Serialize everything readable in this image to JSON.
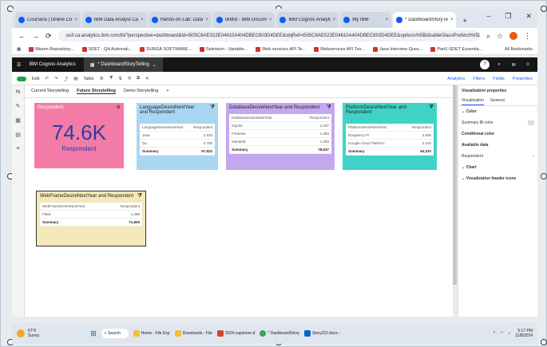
{
  "browser": {
    "tabs": [
      {
        "label": "Coursera | Online Co",
        "active": false
      },
      {
        "label": "IBM Data Analyst Ca",
        "active": false
      },
      {
        "label": "Hands-on Lab: Data",
        "active": false
      },
      {
        "label": "IBMid - IBM Docum",
        "active": false
      },
      {
        "label": "IBM Cognos Analyti",
        "active": false
      },
      {
        "label": "My IBM",
        "active": false
      },
      {
        "label": "* DashboardStoryTe",
        "active": true
      }
    ],
    "new_tab": "+",
    "url": "us3.ca.analytics.ibm.com/bi/?perspective=dashboard&id=i505C8AE022E04610A404DBEC603D4DEE&objRef=i505C8AE022E04610A404DBEC603D4DEE&options%5BdisableGlassPrefetch%5D=true...",
    "bookmarks": [
      "Maven Repository...",
      "SDET - QA Automati...",
      "DURGA SOFTWARE...",
      "Selenium - Variable...",
      "Web services API Te...",
      "Webservices API Tes...",
      "Java Interview Ques...",
      "Part1-SDET Essentia..."
    ],
    "all_bookmarks": "All Bookmarks"
  },
  "cognos": {
    "brand": "IBM Cognos Analytics",
    "doc_tab": "* DashboardStoryTelling",
    "toolbar": {
      "edit": "Edit",
      "table": "Table",
      "analytics": "Analytics",
      "filters": "Filters",
      "fields": "Fields",
      "properties": "Properties"
    },
    "story_tabs": [
      {
        "label": "Current Storytelling",
        "active": false
      },
      {
        "label": "Future Storytelling",
        "active": true
      },
      {
        "label": "Demo Storytelling",
        "active": false
      }
    ],
    "kpi": {
      "title": "Respondent",
      "value": "74.6K",
      "label": "Respondent"
    },
    "widgets": [
      {
        "title": "LanguageDesireNextYear and Respondent",
        "col1": "LanguageDesireNextYear",
        "col2": "Respondent",
        "rows": [
          [
            "Java",
            "2,933"
          ],
          [
            "Go",
            "2,768"
          ]
        ],
        "summary": [
          "Summary",
          "97,922"
        ]
      },
      {
        "title": "DatabaseDesireNextYear and Respondent",
        "col1": "DatabaseDesireNextYear",
        "col2": "Respondent",
        "rows": [
          [
            "SQLite",
            "2,437"
          ],
          [
            "Firebase",
            "1,450"
          ],
          [
            "MariaDB",
            "1,300"
          ]
        ],
        "summary": [
          "Summary",
          "78,637"
        ]
      },
      {
        "title": "PlatformDesireNextYear and Respondent",
        "col1": "PlatformDesireNextYear",
        "col2": "Respondent",
        "rows": [
          [
            "Raspberry Pi",
            "2,605"
          ],
          [
            "Google Cloud Platform",
            "2,410"
          ]
        ],
        "summary": [
          "Summary",
          "64,220"
        ]
      },
      {
        "title": "WebFrameDesireNextYear and Respondent",
        "col1": "WebFrameDesireNextYear",
        "col2": "Respondent",
        "rows": [
          [
            "Flask",
            "1,280"
          ]
        ],
        "summary": [
          "Summary",
          "71,826"
        ]
      }
    ],
    "properties_panel": {
      "title": "Visualization properties",
      "tabs": [
        "Visualization",
        "General"
      ],
      "color_section": "Color",
      "summary_color": "Summary fill color",
      "conditional": "Conditional color",
      "available_data": "Available data",
      "respondent": "Respondent",
      "chart": "Chart",
      "header_icons": "Visualization header icons"
    }
  },
  "taskbar": {
    "weather_temp": "67°F",
    "weather_desc": "Sunny",
    "search": "Search",
    "apps": [
      "Home - File Exp",
      "Downloads - File",
      "2024-capstone-d",
      "* DashboardStory",
      "Story222.docx -"
    ],
    "time": "5:17 PM",
    "date": "11/8/2024"
  },
  "colors": {
    "kpi_bg": "#f27ba8",
    "lang_bg": "#a9d6f2",
    "db_bg": "#c5a7f0",
    "platform_bg": "#3fd3c7",
    "webframe_bg": "#f4e7b8"
  }
}
